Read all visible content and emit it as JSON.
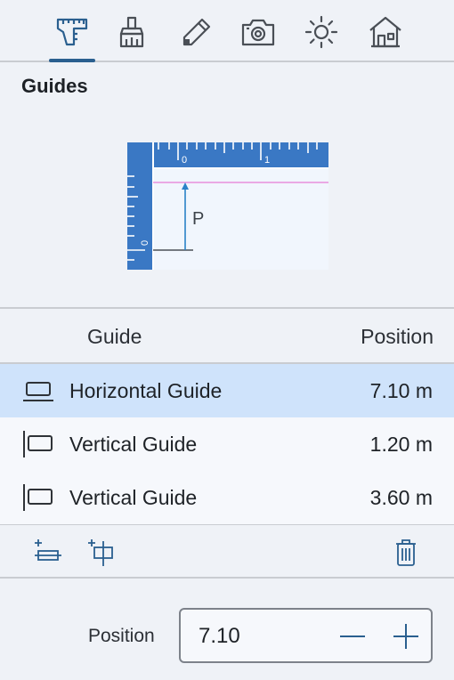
{
  "toolbar": {
    "tools": [
      {
        "name": "measure",
        "icon": "caliper-ruler-icon",
        "active": true
      },
      {
        "name": "paint",
        "icon": "brush-icon",
        "active": false
      },
      {
        "name": "edit",
        "icon": "pencil-icon",
        "active": false
      },
      {
        "name": "camera",
        "icon": "camera-icon",
        "active": false
      },
      {
        "name": "light",
        "icon": "sun-icon",
        "active": false
      },
      {
        "name": "house",
        "icon": "house-icon",
        "active": false
      }
    ]
  },
  "section": {
    "title": "Guides"
  },
  "illustration": {
    "ruler_top_labels": [
      "0",
      "1"
    ],
    "ruler_left_label": "0",
    "marker": "P"
  },
  "table": {
    "headers": {
      "guide": "Guide",
      "position": "Position"
    },
    "rows": [
      {
        "name": "Horizontal Guide",
        "value": "7.10 m",
        "icon": "horizontal-guide-icon",
        "selected": true
      },
      {
        "name": "Vertical Guide",
        "value": "1.20 m",
        "icon": "vertical-guide-icon",
        "selected": false
      },
      {
        "name": "Vertical Guide",
        "value": "3.60 m",
        "icon": "vertical-guide-icon",
        "selected": false
      }
    ]
  },
  "actions": {
    "add_horizontal": "add-horizontal-guide-icon",
    "add_vertical": "add-vertical-guide-icon",
    "delete": "trash-icon"
  },
  "position_field": {
    "label": "Position",
    "value": "7.10"
  },
  "colors": {
    "accent": "#2a5f8f",
    "ruler": "#3a78c4",
    "selected_row": "#cfe3fb",
    "guide_line": "#e57bd6"
  }
}
